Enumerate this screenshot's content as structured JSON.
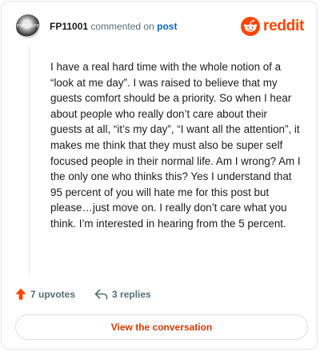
{
  "header": {
    "username": "FP11001",
    "action_text": "commented on",
    "post_link": "post",
    "avatar_text": "PNFSCOPE"
  },
  "brand": {
    "logo_text": "reddit",
    "color": "#ff4500"
  },
  "comment": {
    "body": "I have a real hard time with the whole notion of a “look at me day”. I was raised to believe that my guests comfort should be a priority. So when I hear about people who really don’t care about their guests at all, “it’s my day”, “I want all the attention”, it makes me think that they must also be super self focused people in their normal life. Am I wrong? Am I the only one who thinks this? Yes I understand that 95 percent of you will hate me for this post but please…just move on. I really don’t care what you think. I’m interested in hearing from the 5 percent."
  },
  "actions": {
    "upvotes_label": "7 upvotes",
    "replies_label": "3 replies"
  },
  "footer": {
    "view_conversation_label": "View the conversation"
  },
  "colors": {
    "accent": "#d93a00",
    "link": "#0a66c2",
    "meta": "#576f76"
  },
  "icons": {
    "upvote": "upvote-arrow-icon",
    "reply": "reply-arrow-icon",
    "reddit": "reddit-snoo-icon"
  }
}
